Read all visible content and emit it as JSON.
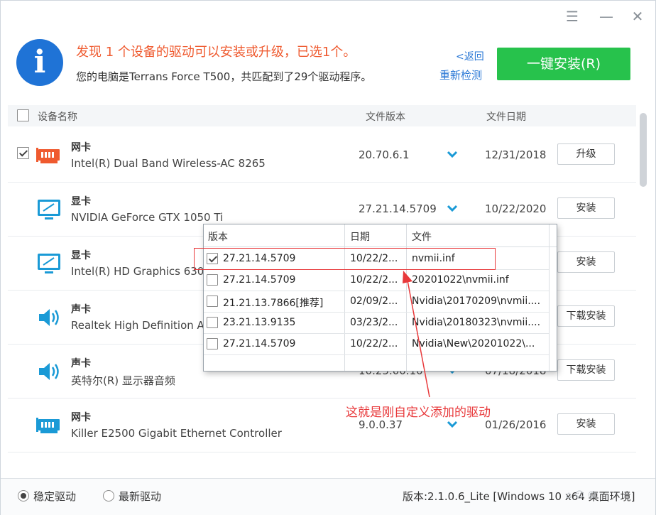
{
  "window": {
    "controls": {
      "menu": "☰",
      "minimize": "—",
      "close": "✕"
    }
  },
  "header": {
    "icon_letter": "i",
    "headline": "发现 1 个设备的驱动可以安装或升级，已选1个。",
    "subline": "您的电脑是Terrans Force T500，共匹配到了29个驱动程序。",
    "back_link": "<返回",
    "recheck_link": "重新检测",
    "install_button": "一键安装(R)"
  },
  "table": {
    "columns": {
      "device": "设备名称",
      "version": "文件版本",
      "date": "文件日期"
    },
    "rows": [
      {
        "checked": true,
        "icon": "network-card-icon",
        "icon_color": "#ef5a2f",
        "type": "网卡",
        "name": "Intel(R) Dual Band Wireless-AC 8265",
        "version": "20.70.6.1",
        "date": "12/31/2018",
        "action": "升级"
      },
      {
        "checked": false,
        "icon": "display-icon",
        "icon_color": "#1a9ad6",
        "type": "显卡",
        "name": "NVIDIA GeForce GTX 1050 Ti",
        "version": "27.21.14.5709",
        "date": "10/22/2020",
        "action": "安装"
      },
      {
        "checked": false,
        "icon": "display-icon",
        "icon_color": "#1a9ad6",
        "type": "显卡",
        "name": "Intel(R) HD Graphics 630",
        "version": "",
        "date": "",
        "action": "安装"
      },
      {
        "checked": false,
        "icon": "speaker-icon",
        "icon_color": "#1a9ad6",
        "type": "声卡",
        "name": "Realtek High Definition Au",
        "version": "",
        "date": "",
        "action": "下载安装"
      },
      {
        "checked": false,
        "icon": "speaker-icon",
        "icon_color": "#1a9ad6",
        "type": "声卡",
        "name": "英特尔(R) 显示器音频",
        "version": "10.25.00.10",
        "date": "07/18/2018",
        "action": "下载安装"
      },
      {
        "checked": false,
        "icon": "network-card-icon",
        "icon_color": "#1a9ad6",
        "type": "网卡",
        "name": "Killer E2500 Gigabit Ethernet Controller",
        "version": "9.0.0.37",
        "date": "01/26/2016",
        "action": "安装"
      }
    ]
  },
  "popup": {
    "columns": {
      "version": "版本",
      "date": "日期",
      "file": "文件"
    },
    "rows": [
      {
        "checked": true,
        "version": "27.21.14.5709",
        "date": "10/22/2...",
        "file": "nvmii.inf"
      },
      {
        "checked": false,
        "version": "27.21.14.5709",
        "date": "10/22/2...",
        "file": "20201022\\nvmii.inf"
      },
      {
        "checked": false,
        "version": "21.21.13.7866[推荐]",
        "date": "02/09/2...",
        "file": "Nvidia\\20170209\\nvmii...."
      },
      {
        "checked": false,
        "version": "23.21.13.9135",
        "date": "03/23/2...",
        "file": "Nvidia\\20180323\\nvmii...."
      },
      {
        "checked": false,
        "version": "27.21.14.5709",
        "date": "10/22/2...",
        "file": "Nvidia\\New\\20201022\\..."
      }
    ]
  },
  "annotation": {
    "text": "这就是刚自定义添加的驱动",
    "color": "#e8393b"
  },
  "footer": {
    "stable_label": "稳定驱动",
    "latest_label": "最新驱动",
    "selected": "stable",
    "version_text": "版本:2.1.0.6_Lite [Windows 10 x64 桌面环境]"
  },
  "colors": {
    "accent": "#27c24c",
    "link": "#2a78d6",
    "headline": "#ef5a2f",
    "info": "#1f73d6"
  }
}
